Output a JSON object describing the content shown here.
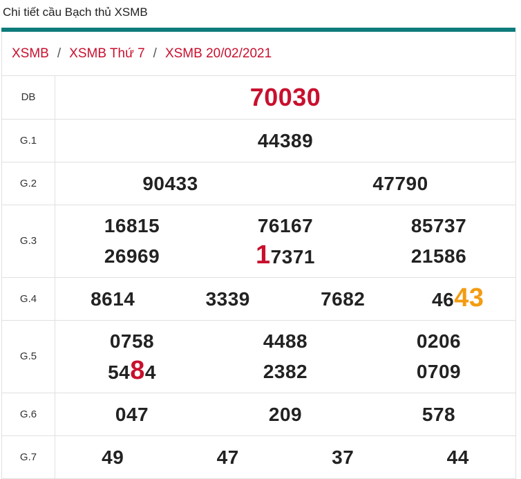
{
  "page": {
    "title": "Chi tiết cầu Bạch thủ XSMB"
  },
  "breadcrumb": [
    {
      "label": "XSMB"
    },
    {
      "label": "XSMB Thứ 7"
    },
    {
      "label": "XSMB 20/02/2021"
    }
  ],
  "breadcrumb_separator": "/",
  "colors": {
    "accent_bar": "#0e7c7b",
    "red": "#c8102e",
    "orange": "#f39c12"
  },
  "results": {
    "db": {
      "label": "DB",
      "numbers": [
        "70030"
      ]
    },
    "g1": {
      "label": "G.1",
      "numbers": [
        "44389"
      ]
    },
    "g2": {
      "label": "G.2",
      "numbers": [
        "90433",
        "47790"
      ]
    },
    "g3": {
      "label": "G.3",
      "numbers": [
        "16815",
        "76167",
        "85737",
        "26969",
        "17371",
        "21586"
      ]
    },
    "g4": {
      "label": "G.4",
      "numbers": [
        "8614",
        "3339",
        "7682",
        "4643"
      ]
    },
    "g5": {
      "label": "G.5",
      "numbers": [
        "0758",
        "4488",
        "0206",
        "5484",
        "2382",
        "0709"
      ]
    },
    "g6": {
      "label": "G.6",
      "numbers": [
        "047",
        "209",
        "578"
      ]
    },
    "g7": {
      "label": "G.7",
      "numbers": [
        "49",
        "47",
        "37",
        "44"
      ]
    }
  },
  "highlights": {
    "g3_17371_lead": "1",
    "g3_17371_rest": "7371",
    "g4_4643_lead": "46",
    "g4_4643_tail": "43",
    "g5_5484_a": "54",
    "g5_5484_b": "8",
    "g5_5484_c": "4"
  }
}
